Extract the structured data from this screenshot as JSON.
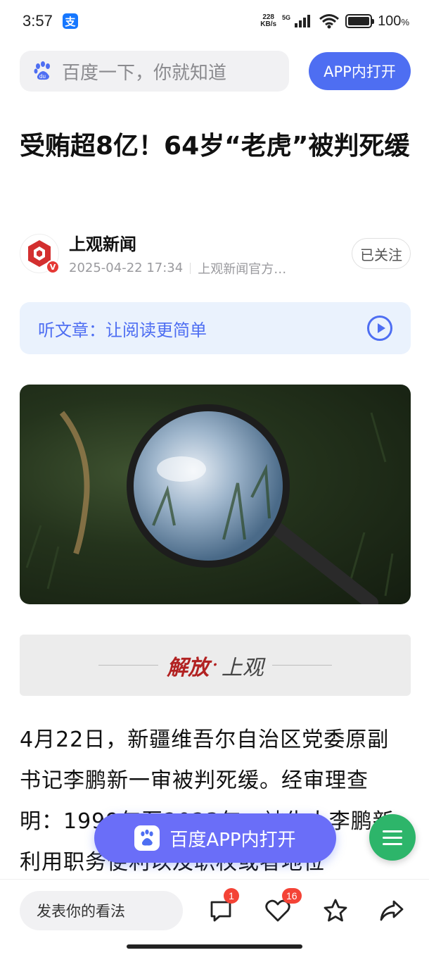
{
  "status_bar": {
    "time": "3:57",
    "app_icon": "支",
    "net_speed_value": "228",
    "net_speed_unit": "KB/s",
    "network_type": "5G",
    "battery": "100",
    "battery_unit": "%"
  },
  "header": {
    "search_placeholder": "百度一下，你就知道",
    "open_app_label": "APP内打开"
  },
  "article": {
    "title": "受贿超8亿！64岁“老虎”被判死缓",
    "author": {
      "name": "上观新闻",
      "date": "2025-04-22 17:34",
      "description": "上观新闻官方…",
      "verified_mark": "V",
      "follow_label": "已关注"
    },
    "listen": {
      "label": "听文章：让阅读更简单"
    },
    "source_logo": {
      "part1": "解放",
      "dot": "·",
      "part2": "上观"
    },
    "body": "4月22日，新疆维吾尔自治区党委原副书记李鹏新一审被判死缓。经审理查明：1999年至2023年，被告人李鹏新利用职务便利以及职权或者地位"
  },
  "floating": {
    "open_app_label": "百度APP内打开"
  },
  "bottom_bar": {
    "comment_placeholder": "发表你的看法",
    "comment_count": "1",
    "like_count": "16"
  },
  "icons": {
    "comment": "comment-icon",
    "like": "heart-icon",
    "favorite": "star-icon",
    "share": "share-icon",
    "menu": "menu-icon",
    "play": "play-icon"
  },
  "colors": {
    "brand_blue": "#4e6ef2",
    "float_button": "#6a6ef8",
    "menu_fab": "#2db56a",
    "badge_red": "#f44336",
    "listen_bg": "#eaf2fd"
  }
}
